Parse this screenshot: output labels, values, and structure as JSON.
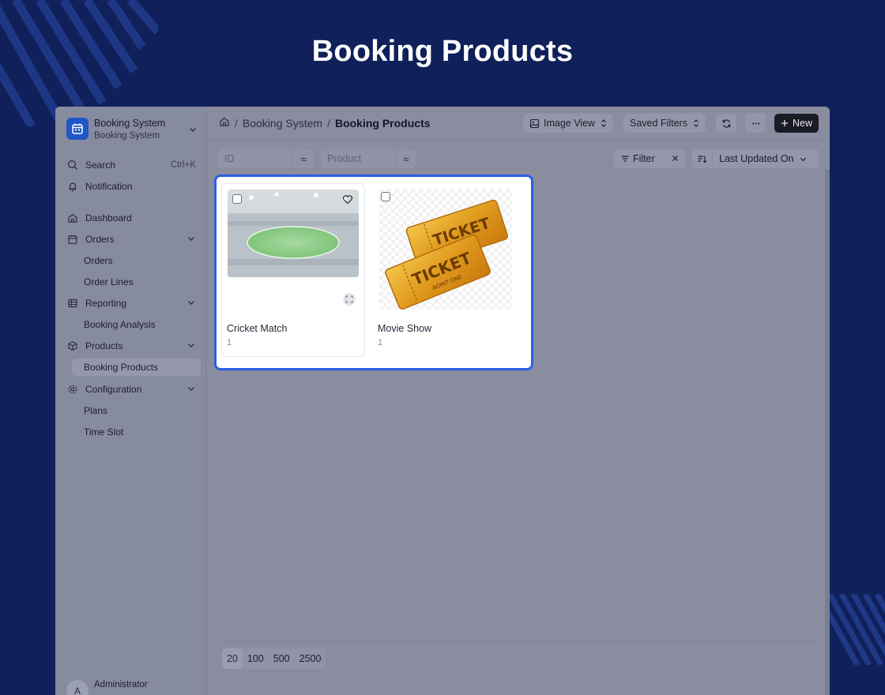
{
  "page_title": "Booking Products",
  "colors": {
    "background": "#10205a",
    "accent": "#2b5fe0",
    "brand": "#1f56c8",
    "overlay": "#8a8d9f"
  },
  "sidebar": {
    "brand_title": "Booking System",
    "brand_subtitle": "Booking System",
    "search_label": "Search",
    "search_shortcut": "Ctrl+K",
    "notification_label": "Notification",
    "items": [
      {
        "label": "Dashboard",
        "icon": "home-icon"
      },
      {
        "label": "Orders",
        "icon": "calendar-icon"
      },
      {
        "label": "Reporting",
        "icon": "table-icon"
      },
      {
        "label": "Products",
        "icon": "box-icon"
      },
      {
        "label": "Configuration",
        "icon": "gear-icon"
      }
    ],
    "sub_items": {
      "orders": [
        "Orders",
        "Order Lines"
      ],
      "reporting": [
        "Booking Analysis"
      ],
      "products": [
        "Booking Products"
      ],
      "configuration": [
        "Plans",
        "Time Slot"
      ]
    },
    "user_name": "Administrator",
    "user_initial": "A"
  },
  "breadcrumb": {
    "parent": "Booking System",
    "current": "Booking Products"
  },
  "toolbar": {
    "view_label": "Image View",
    "saved_filters_label": "Saved Filters",
    "new_label": "New"
  },
  "filters": {
    "id_placeholder": "ID",
    "product_placeholder": "Product",
    "operator_symbol": "≈",
    "filter_label": "Filter",
    "sort_label": "Last Updated On"
  },
  "cards": [
    {
      "name": "Cricket Match",
      "count": "1"
    },
    {
      "name": "Movie Show",
      "count": "1"
    }
  ],
  "pagination": {
    "options": [
      "20",
      "100",
      "500",
      "2500"
    ],
    "selected": "20"
  }
}
